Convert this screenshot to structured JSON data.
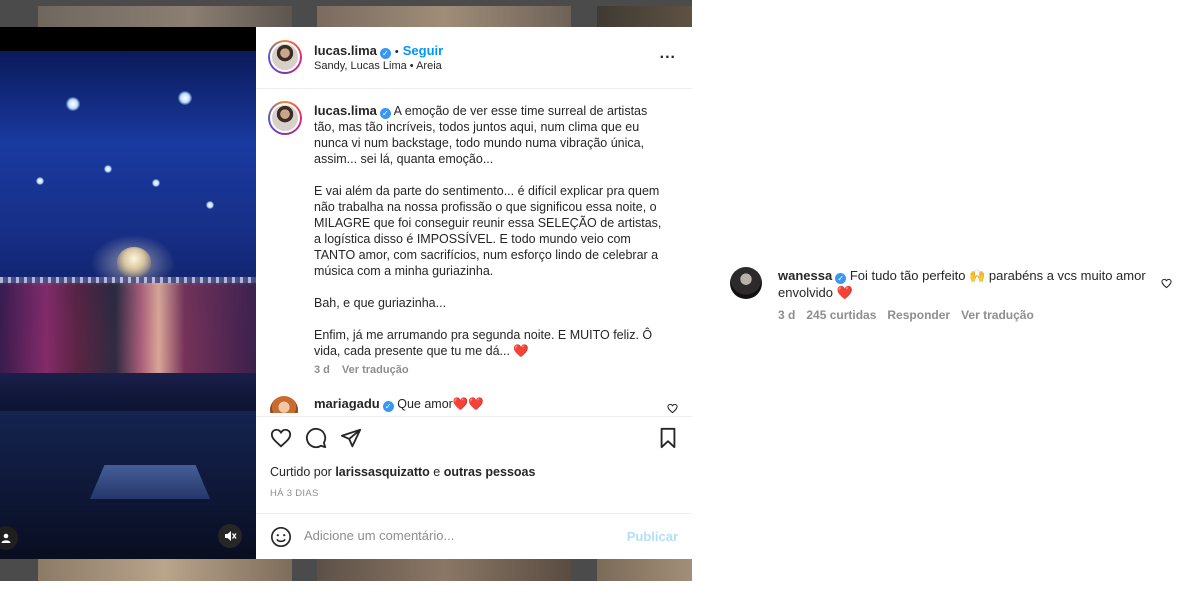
{
  "post": {
    "author": "lucas.lima",
    "follow_label": "Seguir",
    "location": "Sandy, Lucas Lima • Areia",
    "more_label": "...",
    "caption_author": "lucas.lima",
    "caption_para1": "A emoção de ver esse time surreal de artistas tão, mas tão incríveis, todos juntos aqui, num clima que eu nunca vi num backstage, todo mundo numa vibração única, assim... sei lá, quanta emoção...",
    "caption_para2": "E vai além da parte do sentimento... é difícil explicar pra quem não trabalha na nossa profissão o que significou essa noite, o MILAGRE que foi conseguir reunir essa SELEÇÃO de artistas, a logística disso é IMPOSSÍVEL. E todo mundo veio com TANTO amor, com sacrifícios, num esforço lindo de celebrar a música com a minha guriazinha.",
    "caption_para3": "Bah, e que guriazinha...",
    "caption_para4": "Enfim, já me arrumando pra segunda noite. E MUITO feliz. Ô vida, cada presente que tu me dá... ❤️",
    "caption_age": "3 d",
    "caption_translate": "Ver tradução",
    "first_comment_author": "mariagadu",
    "first_comment_text": "Que amor❤️❤️",
    "likes_prefix": "Curtido por",
    "likes_user": "larissasquizatto",
    "likes_conj": "e",
    "likes_others": "outras pessoas",
    "timestamp": "HÁ 3 DIAS",
    "comment_placeholder": "Adicione um comentário...",
    "publish_label": "Publicar"
  },
  "side_comment": {
    "author": "wanessa",
    "text": "Foi tudo tão perfeito 🙌 parabéns a vcs muito amor envolvido ❤️",
    "age": "3 d",
    "likes": "245 curtidas",
    "reply": "Responder",
    "translate": "Ver tradução"
  },
  "icons": {
    "verified": "verified-badge-icon",
    "like": "heart-icon",
    "comment": "comment-bubble-icon",
    "share": "paper-plane-icon",
    "save": "bookmark-icon",
    "emoji": "emoji-smile-icon",
    "mute": "speaker-muted-icon",
    "user_tag": "user-tag-icon"
  },
  "colors": {
    "accent_blue": "#0095f6",
    "verified_blue": "#3897f0",
    "publish_disabled": "#b2dffc",
    "muted_text": "#8e8e8e",
    "heart_red": "#ed4956"
  }
}
